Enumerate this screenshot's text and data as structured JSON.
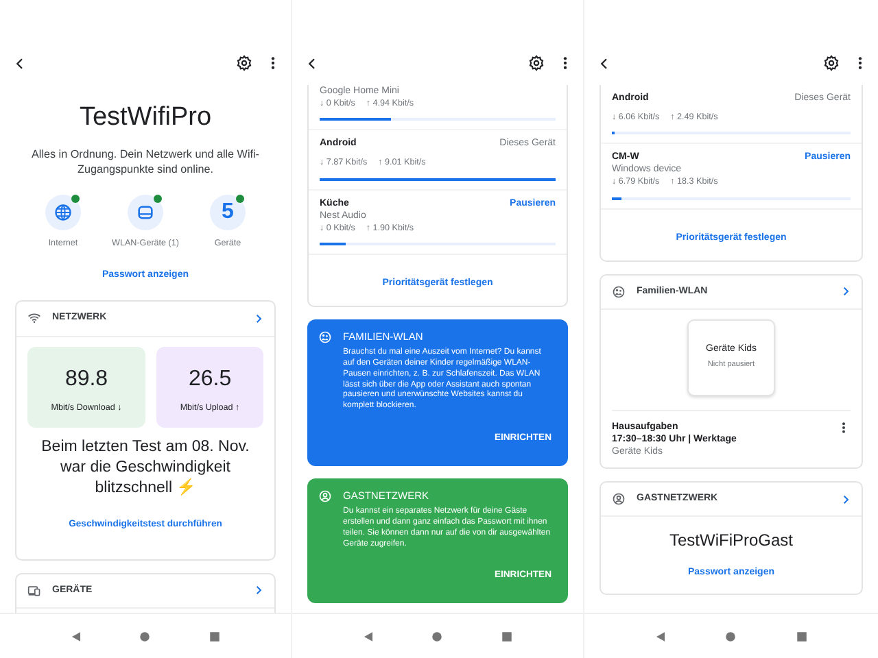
{
  "screens": [
    {
      "sections": [
        {
          "kind": "hero",
          "title": "TestWifiPro",
          "text": "Alles in Ordnung. Dein Netzwerk und alle Wifi-Zugangspunkte sind online.",
          "status_items": [
            {
              "label": "Internet",
              "online": true
            },
            {
              "label": "WLAN-Geräte (1)",
              "online": true
            },
            {
              "count": "5",
              "label": "Geräte",
              "online": true
            }
          ],
          "link": "Passwort anzeigen"
        },
        {
          "kind": "speed_card",
          "title": "NETZWERK",
          "speeds": [
            {
              "value": "89.8",
              "label": "Mbit/s Download ↓",
              "color": "#e6f4ea"
            },
            {
              "value": "26.5",
              "label": "Mbit/s Upload ↑",
              "color": "#f1e8fd"
            }
          ],
          "text": "Beim letzten Test am 08. Nov. war die Geschwindigkeit blitzschnell ⚡",
          "link": "Geschwindigkeitstest durchführen"
        },
        {
          "kind": "header_card",
          "title": "GERÄTE"
        }
      ]
    },
    {
      "sections": [
        {
          "kind": "devices_card",
          "devices": [
            {
              "subtitle": "Google Home Mini",
              "down": "↓ 0 Kbit/s",
              "up": "↑ 4.94 Kbit/s",
              "level": 0.3
            },
            {
              "name": "Android",
              "tag": "Dieses Gerät",
              "down": "↓ 7.87 Kbit/s",
              "up": "↑ 9.01 Kbit/s",
              "level": 1
            },
            {
              "name": "Küche",
              "subtitle": "Nest Audio",
              "action": "Pausieren",
              "down": "↓ 0 Kbit/s",
              "up": "↑ 1.90 Kbit/s",
              "level": 0.11
            }
          ],
          "link": "Prioritätsgerät festlegen"
        },
        {
          "kind": "promo",
          "color": "#1a73e8",
          "title": "FAMILIEN-WLAN",
          "text": "Brauchst du mal eine Auszeit vom Internet? Du kannst auf den Geräten deiner Kinder regelmäßige WLAN-Pausen einrichten, z. B. zur Schlafenszeit. Das WLAN lässt sich über die App oder Assistant auch spontan pausieren und unerwünschte Websites kannst du komplett blockieren.",
          "button": "EINRICHTEN"
        },
        {
          "kind": "promo",
          "color": "#34a853",
          "title": "GASTNETZWERK",
          "text": "Du kannst ein separates Netzwerk für deine Gäste erstellen und dann ganz einfach das Passwort mit ihnen teilen. Sie können dann nur auf die von dir ausgewählten Geräte zugreifen.",
          "button": "EINRICHTEN"
        }
      ]
    },
    {
      "sections": [
        {
          "kind": "devices_card",
          "devices": [
            {
              "name": "Android",
              "tag": "Dieses Gerät",
              "down": "↓ 6.06 Kbit/s",
              "up": "↑ 2.49 Kbit/s",
              "level": 0.01
            },
            {
              "name": "CM-W",
              "subtitle": "Windows device",
              "action": "Pausieren",
              "down": "↓ 6.79 Kbit/s",
              "up": "↑ 18.3 Kbit/s",
              "level": 0.04
            }
          ],
          "link": "Prioritätsgerät festlegen"
        },
        {
          "kind": "family_card",
          "title": "Familien-WLAN",
          "group": {
            "name": "Geräte Kids",
            "state": "Nicht pausiert"
          },
          "schedule": {
            "title": "Hausaufgaben",
            "time": "17:30–18:30 Uhr | Werktage",
            "group": "Geräte Kids"
          }
        },
        {
          "kind": "guest_card",
          "title": "GASTNETZWERK",
          "network": "TestWiFiProGast",
          "link": "Passwort anzeigen"
        }
      ]
    }
  ]
}
